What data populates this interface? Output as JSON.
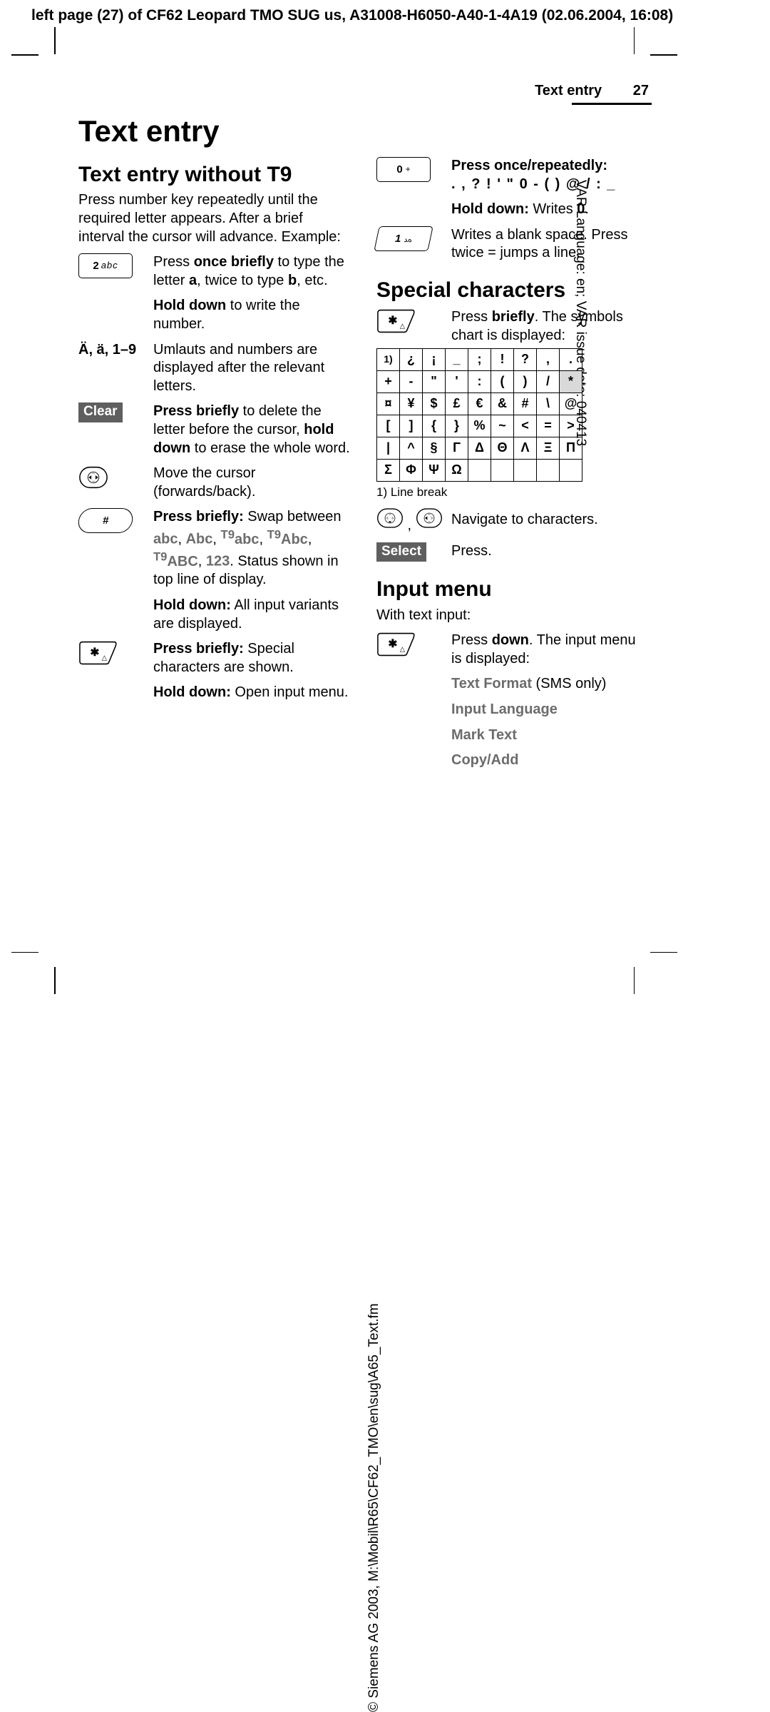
{
  "header": "left page (27) of CF62 Leopard TMO SUG us, A31008-H6050-A40-1-4A19 (02.06.2004, 16:08)",
  "side_right": "VAR Language: en; VAR issue date: 040413",
  "side_left": "© Siemens AG 2003, M:\\Mobil\\R65\\CF62_TMO\\en\\sug\\A65_Text.fm",
  "running_section": "Text entry",
  "running_page": "27",
  "title": "Text entry",
  "left": {
    "h2": "Text entry without T9",
    "intro": "Press number key repeatedly until the required letter appears. After a brief interval the cursor will advance. Example:",
    "key2_bold": "2",
    "key2_light": "abc",
    "key2_a": "Press ",
    "key2_b": "once briefly",
    "key2_c": " to type the letter ",
    "key2_d": "a",
    "key2_e": ", twice to type ",
    "key2_f": "b",
    "key2_g": ", etc.",
    "key2_h": "Hold down",
    "key2_i": " to write the number.",
    "umlaut_label": "Ä, ä, 1–9",
    "umlaut_text": "Umlauts and numbers are displayed after the relevant letters.",
    "clear_label": "Clear",
    "clear_a": "Press briefly",
    "clear_b": " to delete the letter before the cursor, ",
    "clear_c": "hold down",
    "clear_d": " to erase the whole word.",
    "nav_text": "Move the cursor (forwards/back).",
    "hash_key": "#",
    "hash_a": "Press briefly:",
    "hash_b": " Swap between ",
    "hash_m1": "abc",
    "hash_m2": "Abc",
    "hash_m3_sup": "T9",
    "hash_m3": "abc",
    "hash_m4_sup": "T9",
    "hash_m4": "Abc",
    "hash_m5_sup": "T9",
    "hash_m5": "ABC",
    "hash_m6": "123",
    "hash_c": ". Status shown in top line of display.",
    "hash_hold_a": "Hold down:",
    "hash_hold_b": " All input variants are displayed.",
    "star_a": "Press briefly:",
    "star_b": " Special characters are shown.",
    "star_hold_a": "Hold down:",
    "star_hold_b": " Open input menu."
  },
  "right": {
    "key0_bold": "0",
    "key0_plus": "+",
    "zero_head": "Press once/repeatedly:",
    "zero_chars": ". , ? ! ' \" 0 - ( ) @ / : _",
    "zero_hold_a": "Hold down:",
    "zero_hold_b": " Writes ",
    "zero_hold_c": "0",
    "key1_bold": "1",
    "key1_light": "",
    "one_a": "Writes a blank space. Press twice = jumps a line.",
    "h2_special": "Special characters",
    "spec_a": "Press ",
    "spec_b": "briefly",
    "spec_c": ". The symbols chart is displayed:",
    "footnote": "1) Line break",
    "nav_text": "Navigate to characters.",
    "select_label": "Select",
    "select_text": "Press.",
    "h2_input": "Input menu",
    "input_intro": "With text input:",
    "input_a": "Press ",
    "input_b": "down",
    "input_c": ". The input menu is displayed:",
    "menu1a": "Text Format",
    "menu1b": " (SMS only)",
    "menu2": "Input Language",
    "menu3": "Mark Text",
    "menu4": "Copy/Add"
  },
  "chart_data": {
    "type": "table",
    "title": "Special characters chart",
    "rows": [
      [
        "1)",
        "¿",
        "¡",
        "_",
        ";",
        "!",
        "?",
        ",",
        "."
      ],
      [
        "+",
        "-",
        "\"",
        "'",
        ":",
        "(",
        ")",
        "/",
        "*"
      ],
      [
        "¤",
        "¥",
        "$",
        "£",
        "€",
        "&",
        "#",
        "\\",
        "@"
      ],
      [
        "[",
        "]",
        "{",
        "}",
        "%",
        "~",
        "<",
        "=",
        ">"
      ],
      [
        "|",
        "^",
        "§",
        "Γ",
        "Δ",
        "Θ",
        "Λ",
        "Ξ",
        "Π"
      ],
      [
        "Σ",
        "Φ",
        "Ψ",
        "Ω",
        "",
        "",
        "",
        "",
        ""
      ]
    ],
    "shaded": [
      [
        1,
        8
      ]
    ],
    "footnote": "1) Line break"
  }
}
